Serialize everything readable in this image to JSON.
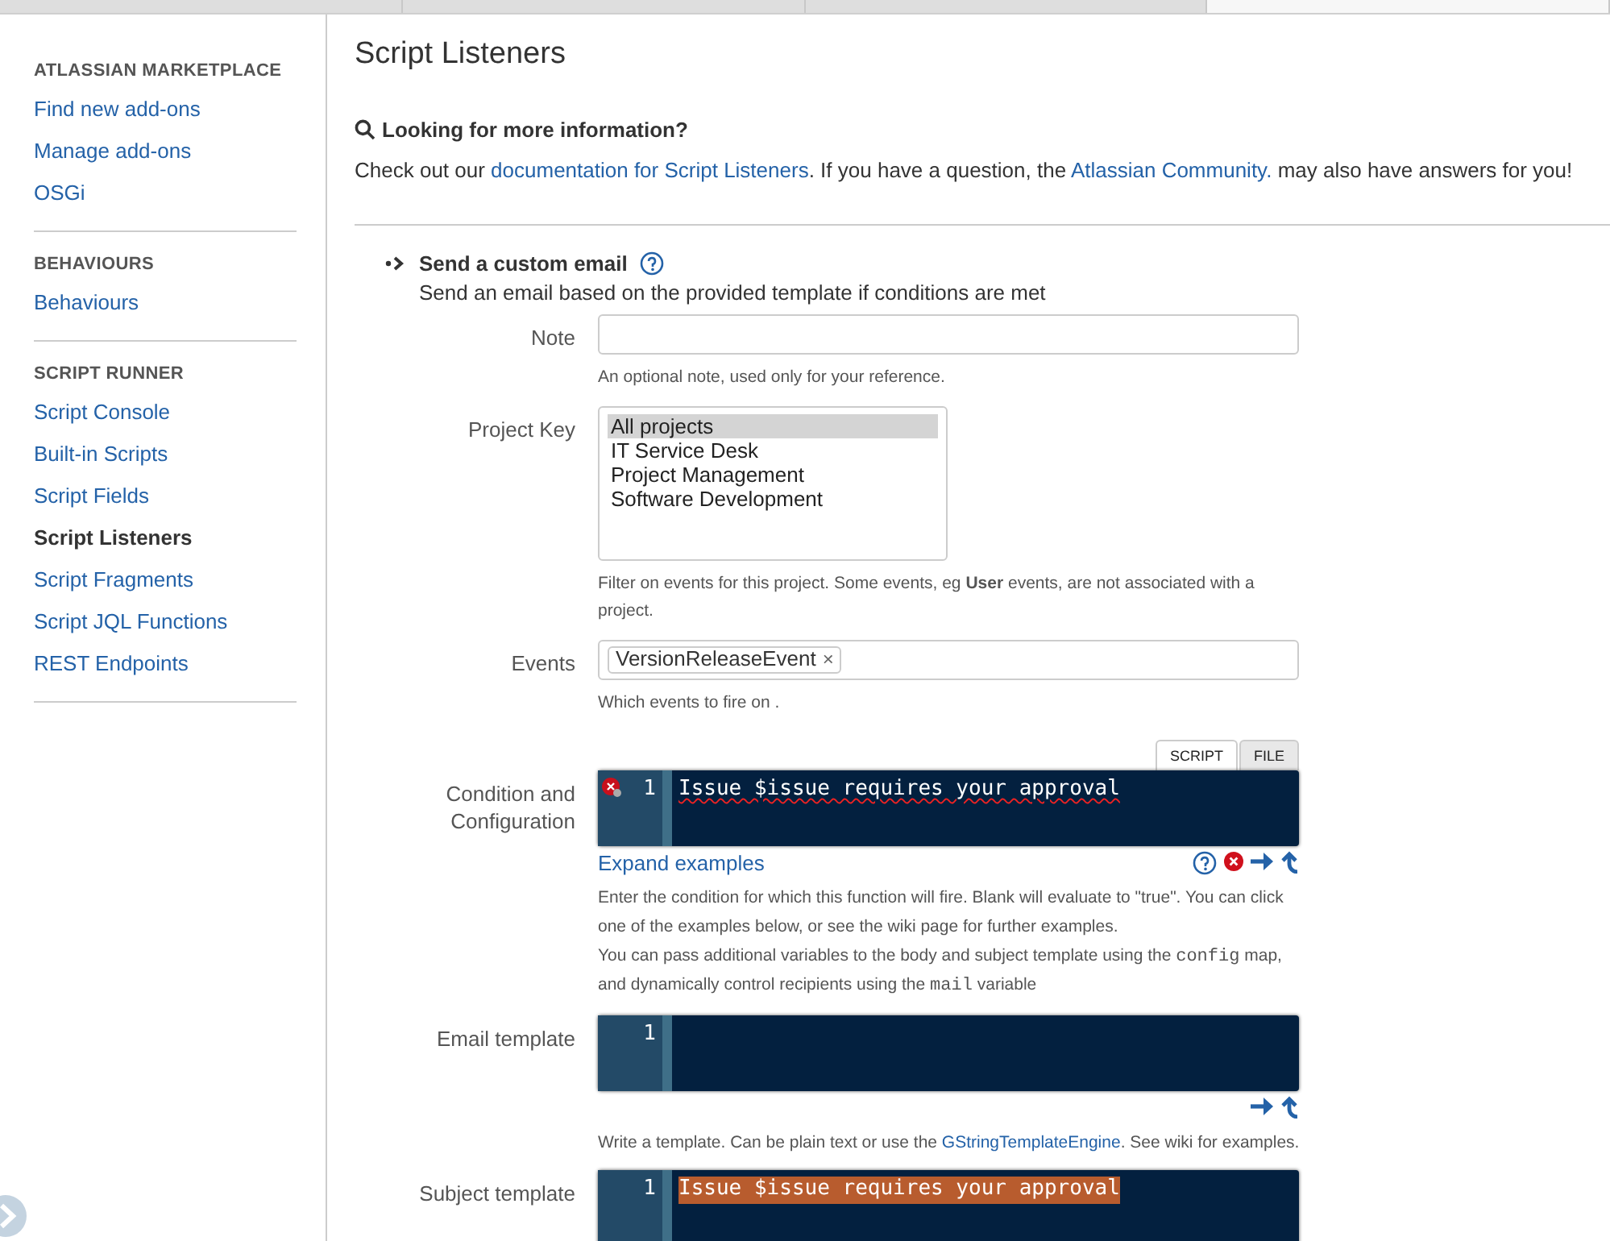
{
  "browser_tabs": [
    {
      "selected": false
    },
    {
      "selected": false
    },
    {
      "selected": false
    },
    {
      "selected": true
    }
  ],
  "sidebar": {
    "sections": [
      {
        "heading": "ATLASSIAN MARKETPLACE",
        "items": [
          {
            "label": "Find new add-ons",
            "selected": false
          },
          {
            "label": "Manage add-ons",
            "selected": false
          },
          {
            "label": "OSGi",
            "selected": false
          }
        ]
      },
      {
        "heading": "BEHAVIOURS",
        "items": [
          {
            "label": "Behaviours",
            "selected": false
          }
        ]
      },
      {
        "heading": "SCRIPT RUNNER",
        "items": [
          {
            "label": "Script Console",
            "selected": false
          },
          {
            "label": "Built-in Scripts",
            "selected": false
          },
          {
            "label": "Script Fields",
            "selected": false
          },
          {
            "label": "Script Listeners",
            "selected": true
          },
          {
            "label": "Script Fragments",
            "selected": false
          },
          {
            "label": "Script JQL Functions",
            "selected": false
          },
          {
            "label": "REST Endpoints",
            "selected": false
          }
        ]
      }
    ]
  },
  "page": {
    "title": "Script Listeners",
    "info_heading": "Looking for more information?",
    "info_text": [
      {
        "kind": "text",
        "text": "Check out our "
      },
      {
        "kind": "link",
        "text": "documentation for Script Listeners"
      },
      {
        "kind": "text",
        "text": ". If you have a question, the "
      },
      {
        "kind": "link",
        "text": "Atlassian Community."
      },
      {
        "kind": "text",
        "text": " may also have answers for you!"
      }
    ]
  },
  "listener": {
    "title": "Send a custom email",
    "description": "Send an email based on the provided template if conditions are met",
    "fields": [
      {
        "kind": "text",
        "label": "Note",
        "hint": [
          [
            {
              "kind": "text",
              "text": "An optional note, used only for your reference."
            }
          ]
        ]
      },
      {
        "kind": "listbox",
        "label": "Project Key",
        "options": [
          {
            "label": "All projects",
            "selected": true
          },
          {
            "label": "IT Service Desk",
            "selected": false
          },
          {
            "label": "Project Management",
            "selected": false
          },
          {
            "label": "Software Development",
            "selected": false
          }
        ],
        "hint": [
          [
            {
              "kind": "text",
              "text": "Filter on events for this project. Some events, eg "
            },
            {
              "kind": "bold",
              "text": "User"
            },
            {
              "kind": "text",
              "text": " events, are not associated with a project."
            }
          ]
        ]
      },
      {
        "kind": "tags",
        "label": "Events",
        "tags": [
          "VersionReleaseEvent"
        ],
        "remove": "×",
        "hint": [
          [
            {
              "kind": "text",
              "text": "Which events to fire on ."
            }
          ]
        ]
      },
      {
        "kind": "code",
        "label": "Condition and Configuration",
        "tabs": [
          {
            "label": "SCRIPT",
            "selected": true
          },
          {
            "label": "FILE",
            "selected": false
          }
        ],
        "lines": [
          {
            "number": "1",
            "text": "Issue $issue requires your approval",
            "error": true,
            "selected": false
          }
        ],
        "link": "Expand examples",
        "validation": true,
        "hint": [
          [
            {
              "kind": "text",
              "text": "Enter the condition for which this function will fire. Blank will evaluate to \"true\". You can click one of the examples below, or see the wiki page for further examples."
            }
          ],
          [
            {
              "kind": "text",
              "text": "You can pass additional variables to the body and subject template using the "
            },
            {
              "kind": "code",
              "text": "config"
            },
            {
              "kind": "text",
              "text": " map, and dynamically control recipients using the "
            },
            {
              "kind": "code",
              "text": "mail"
            },
            {
              "kind": "text",
              "text": " variable"
            }
          ]
        ]
      },
      {
        "kind": "code",
        "label": "Email template",
        "lines": [
          {
            "number": "1"
          }
        ],
        "validation": false,
        "hint": [
          [
            {
              "kind": "text",
              "text": "Write a template. Can be plain text or use the "
            },
            {
              "kind": "link",
              "text": "GStringTemplateEngine"
            },
            {
              "kind": "text",
              "text": ". See wiki for examples."
            }
          ]
        ]
      },
      {
        "kind": "code",
        "label": "Subject template",
        "lines": [
          {
            "number": "1",
            "text": "Issue $issue requires your approval",
            "error": false,
            "selected": true
          }
        ]
      }
    ]
  }
}
